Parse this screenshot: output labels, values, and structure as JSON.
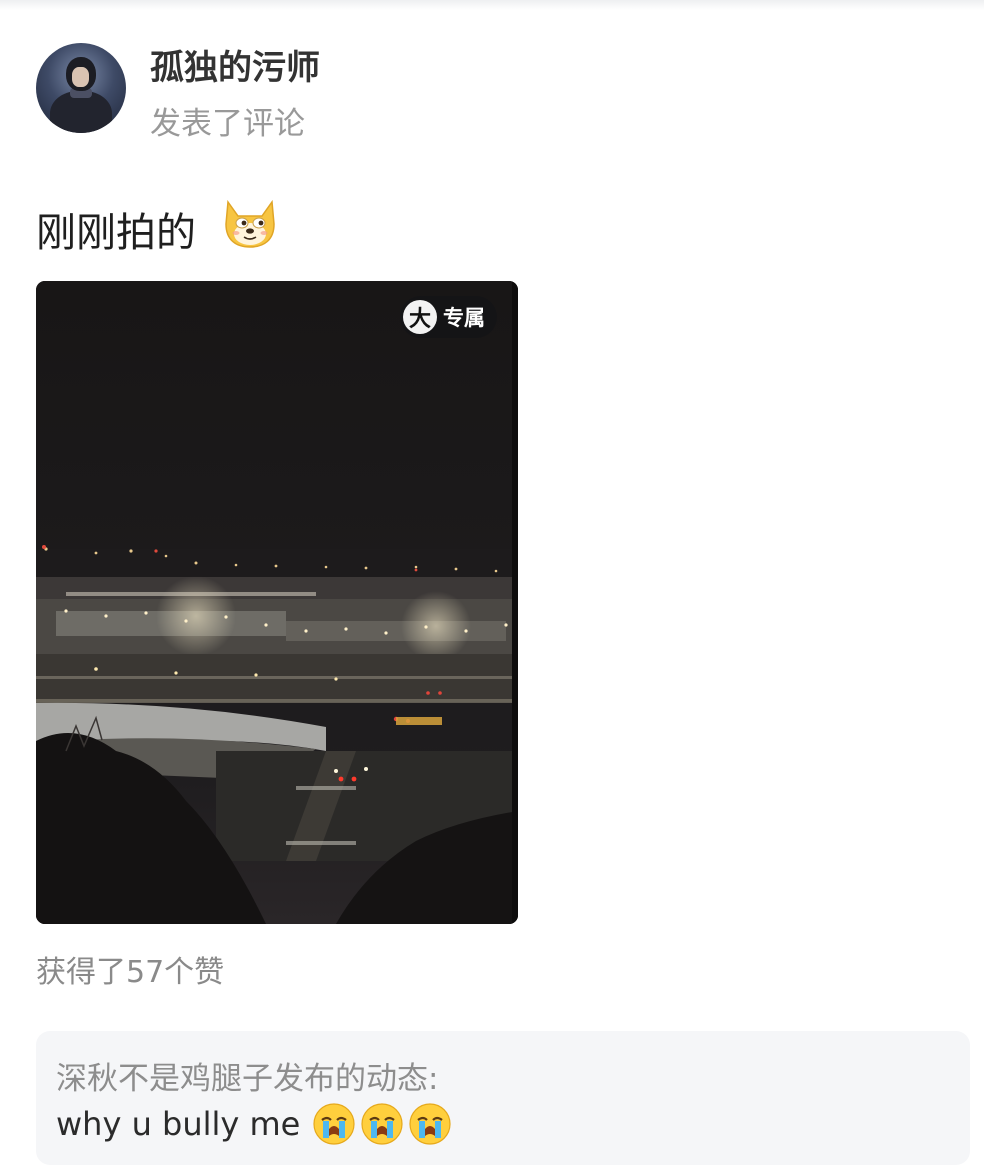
{
  "post": {
    "author": "孤独的污师",
    "action": "发表了评论",
    "text": "刚刚拍的",
    "text_emoji": "doge-emoji",
    "photo_badge": {
      "icon_letter": "大",
      "label": "专属"
    },
    "likes": "获得了57个赞"
  },
  "quote": {
    "source": "深秋不是鸡腿子发布的动态:",
    "text": "why u bully me",
    "emojis": [
      "crying-emoji",
      "crying-emoji",
      "crying-emoji"
    ]
  },
  "colors": {
    "username": "#333333",
    "secondary": "#999999",
    "card_bg": "#f5f6f8"
  }
}
